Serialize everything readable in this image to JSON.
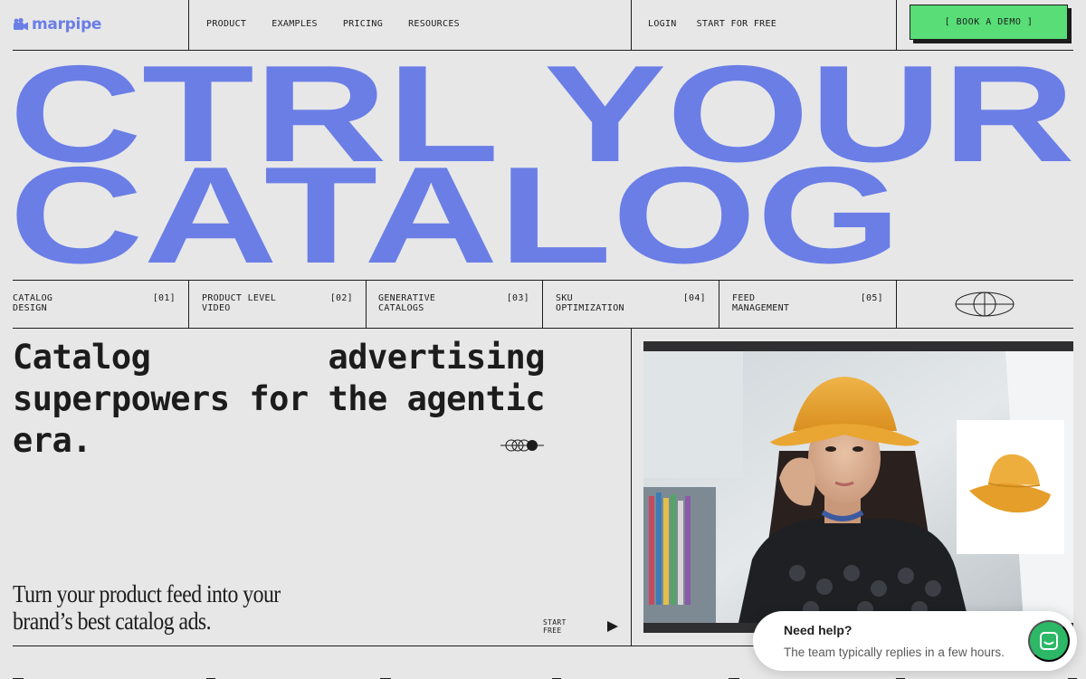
{
  "brand": {
    "name": "marpipe",
    "color": "#6a7ee6"
  },
  "nav": {
    "links": [
      "PRODUCT",
      "EXAMPLES",
      "PRICING",
      "RESOURCES"
    ],
    "login": "LOGIN",
    "start": "START FOR FREE",
    "demo": "[ BOOK A DEMO ]",
    "demo_color": "#58dd77"
  },
  "headline": {
    "line1": "CTRL YOUR",
    "line2": "CATALOG",
    "color": "#6a7ee6"
  },
  "categories": [
    {
      "label": "CATALOG\nDESIGN",
      "num": "[01]"
    },
    {
      "label": "PRODUCT LEVEL\nVIDEO",
      "num": "[02]"
    },
    {
      "label": "GENERATIVE\nCATALOGS",
      "num": "[03]"
    },
    {
      "label": "SKU\nOPTIMIZATION",
      "num": "[04]"
    },
    {
      "label": "FEED\nMANAGEMENT",
      "num": "[05]"
    }
  ],
  "tagline": "Catalog advertising superpowers for the agentic era.",
  "subtext": "Turn your product feed into your brand’s best catalog ads.",
  "start_free": "START\nFREE",
  "chat": {
    "title": "Need help?",
    "subtitle": "The team typically replies in a few hours.",
    "button_color": "#2cb866"
  },
  "icons": {
    "globe": "globe-icon",
    "loops": "loops-icon",
    "play": "play-icon",
    "chat": "chat-icon",
    "logo": "marpipe-logo-icon"
  }
}
